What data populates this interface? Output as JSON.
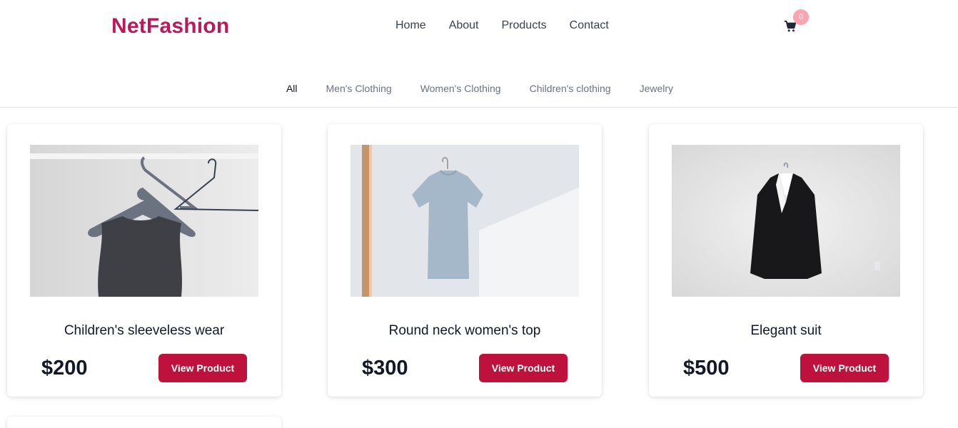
{
  "brand": {
    "name": "NetFashion",
    "color": "#be185d"
  },
  "nav": {
    "items": [
      "Home",
      "About",
      "Products",
      "Contact"
    ]
  },
  "cart": {
    "icon": "shopping-cart-icon",
    "count": "0"
  },
  "categories": {
    "items": [
      "All",
      "Men's Clothing",
      "Women's Clothing",
      "Children's clothing",
      "Jewelry"
    ],
    "active": "All"
  },
  "products": [
    {
      "name": "Children's sleeveless wear",
      "price": "$200",
      "button": "View Product"
    },
    {
      "name": "Round neck women's top",
      "price": "$300",
      "button": "View Product"
    },
    {
      "name": "Elegant suit",
      "price": "$500",
      "button": "View Product"
    }
  ],
  "colors": {
    "accent": "#be123c",
    "badge": "#fda4af"
  }
}
